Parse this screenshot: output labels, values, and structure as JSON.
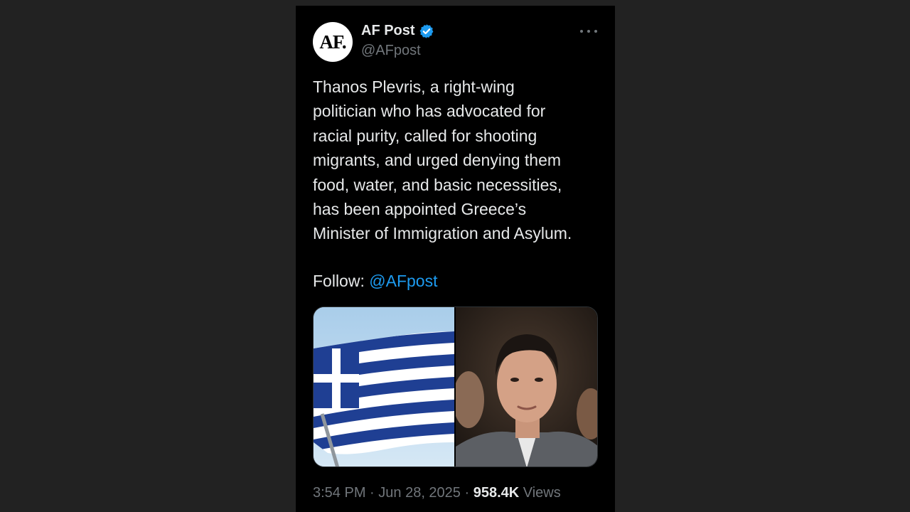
{
  "tweet": {
    "author": {
      "avatar_text": "AF.",
      "display_name": "AF Post",
      "handle": "@AFpost",
      "verified_icon": "verified-badge-icon"
    },
    "more_icon": "more-horizontal-icon",
    "text": "Thanos Plevris, a right-wing\npolitician who has advocated for\nracial purity, called for shooting\nmigrants, and urged denying them\nfood, water, and basic necessities,\nhas been appointed Greece’s\nMinister of Immigration and Asylum.",
    "follow_label": "Follow: ",
    "follow_mention": "@AFpost",
    "media": [
      {
        "kind": "photo",
        "subject": "greek-flag"
      },
      {
        "kind": "photo",
        "subject": "portrait"
      }
    ],
    "meta": {
      "time": "3:54 PM",
      "separator": " · ",
      "date": "Jun 28, 2025",
      "views_count": "958.4K",
      "views_label": " Views"
    }
  },
  "colors": {
    "background": "#222222",
    "card": "#000000",
    "text": "#e7e9ea",
    "muted": "#71767b",
    "link": "#1d9bf0"
  }
}
